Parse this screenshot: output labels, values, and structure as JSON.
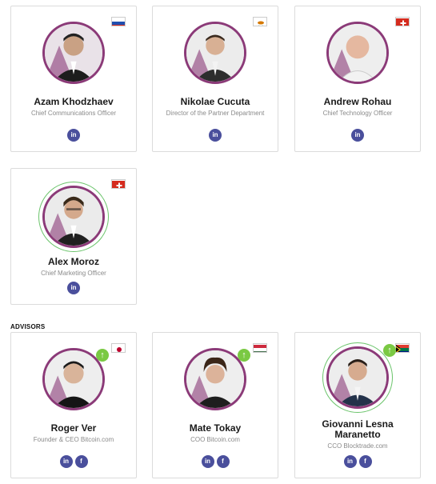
{
  "team": [
    {
      "name": "Azam Khodzhaev",
      "role": "Chief Communications Officer",
      "flag": "russia",
      "socials": [
        "in"
      ]
    },
    {
      "name": "Nikolae Cucuta",
      "role": "Director of the Partner Department",
      "flag": "cyprus",
      "socials": [
        "in"
      ]
    },
    {
      "name": "Andrew Rohau",
      "role": "Chief Technology Officer",
      "flag": "switzerland",
      "socials": [
        "in"
      ]
    },
    {
      "name": "Alex Moroz",
      "role": "Chief Marketing Officer",
      "flag": "switzerland",
      "socials": [
        "in"
      ]
    }
  ],
  "advisors_label": "ADVISORS",
  "advisors": [
    {
      "name": "Roger Ver",
      "role": "Founder & CEO Bitcoin.com",
      "flag": "japan",
      "socials": [
        "in",
        "f"
      ]
    },
    {
      "name": "Mate Tokay",
      "role": "COO Bitcoin.com",
      "flag": "hungary",
      "socials": [
        "in",
        "f"
      ]
    },
    {
      "name": "Giovanni Lesna Maranetto",
      "role": "CCO Blocktrade.com",
      "flag": "south-africa",
      "socials": [
        "in",
        "f"
      ]
    }
  ],
  "colors": {
    "ring": "#8b3a78",
    "green_ring": "#6bc46b",
    "social": "#4a4f9c",
    "badge": "#7ac943"
  },
  "icons": {
    "linkedin": "in",
    "facebook": "f",
    "upvote": "↑"
  }
}
